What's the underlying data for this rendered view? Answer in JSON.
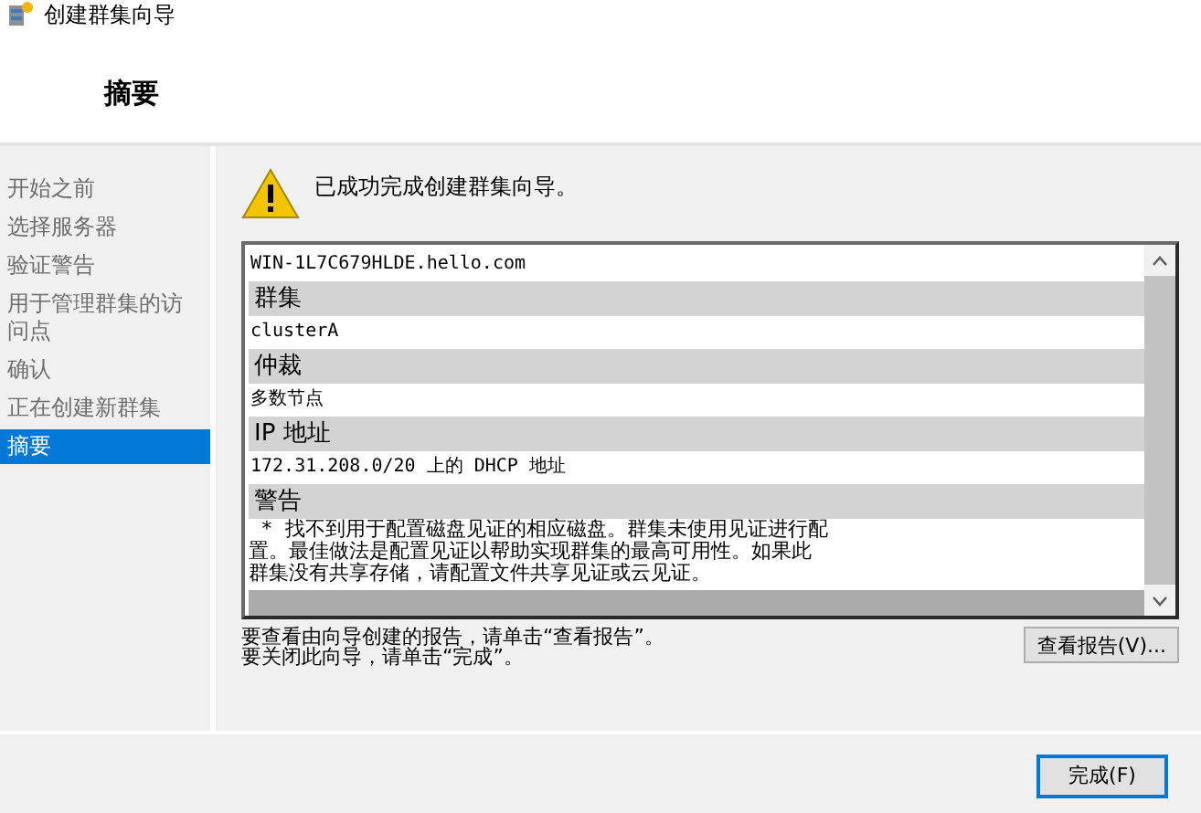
{
  "window": {
    "title": "创建群集向导"
  },
  "heading": "摘要",
  "steps": [
    {
      "label": "开始之前",
      "selected": false
    },
    {
      "label": "选择服务器",
      "selected": false
    },
    {
      "label": "验证警告",
      "selected": false
    },
    {
      "label": "用于管理群集的访问点",
      "selected": false
    },
    {
      "label": "确认",
      "selected": false
    },
    {
      "label": "正在创建新群集",
      "selected": false
    },
    {
      "label": "摘要",
      "selected": true
    }
  ],
  "message": "已成功完成创建群集向导。",
  "report": {
    "host": "WIN-1L7C679HLDE.hello.com",
    "sections": [
      {
        "heading": "群集",
        "lines": [
          "clusterA"
        ]
      },
      {
        "heading": "仲裁",
        "lines": [
          "多数节点"
        ]
      },
      {
        "heading": "IP 地址",
        "lines": [
          "172.31.208.0/20 上的 DHCP 地址"
        ]
      },
      {
        "heading": "警告",
        "lines": [
          " * 找不到用于配置磁盘见证的相应磁盘。群集未使用见证进行配",
          "置。最佳做法是配置见证以帮助实现群集的最高可用性。如果此",
          "群集没有共享存储，请配置文件共享见证或云见证。"
        ]
      }
    ]
  },
  "notes": [
    "要查看由向导创建的报告，请单击“查看报告”。",
    "要关闭此向导，请单击“完成”。"
  ],
  "view_report_button": "查看报告(V)...",
  "finish_button": "完成(F)"
}
